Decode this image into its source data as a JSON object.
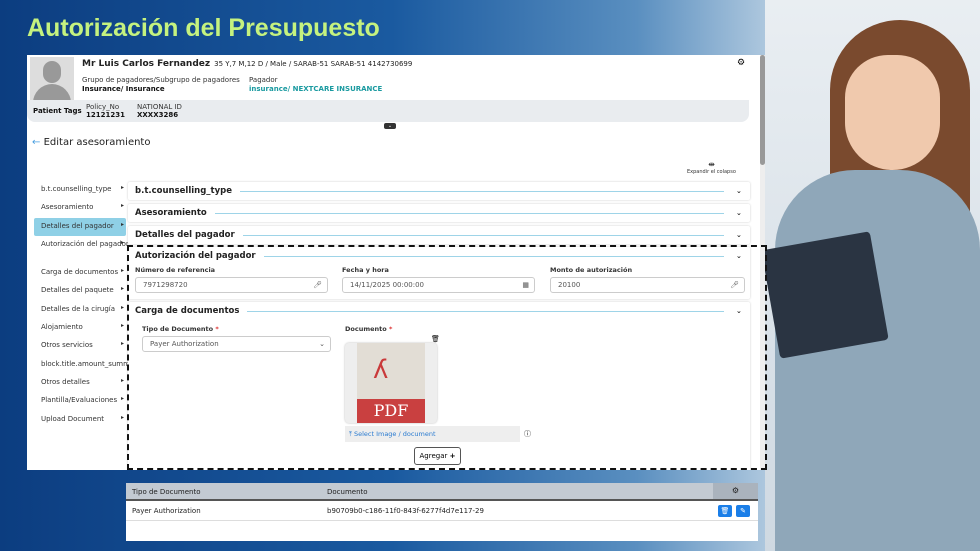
{
  "title": "Autorización del Presupuesto",
  "patient": {
    "name": "Mr Luis Carlos Fernandez",
    "details": "35 Y,7 M,12 D / Male / SARAB-51   SARAB-51   4142730699",
    "group_label": "Grupo de pagadores/Subgrupo de pagadores",
    "group_value": "Insurance/ Insurance",
    "payer_label": "Pagador",
    "payer_value": "insurance/ NEXTCARE INSURANCE",
    "tags_label": "Patient Tags",
    "policy_label": "Policy_No",
    "policy_value": "12121231",
    "national_label": "NATIONAL ID",
    "national_value": "XXXX3286"
  },
  "page_title": "Editar asesoramiento",
  "expand_label": "Expandir el colapso",
  "nav": [
    {
      "label": "b.t.counselling_type"
    },
    {
      "label": "Asesoramiento"
    },
    {
      "label": "Detalles del pagador",
      "active": true
    },
    {
      "label": "Autorización del pagador"
    },
    {
      "label": "Carga de documentos"
    },
    {
      "label": "Detalles del paquete"
    },
    {
      "label": "Detalles de la cirugía"
    },
    {
      "label": "Alojamiento"
    },
    {
      "label": "Otros servicios"
    },
    {
      "label": "block.title.amount_summary"
    },
    {
      "label": "Otros detalles"
    },
    {
      "label": "Plantilla/Evaluaciones"
    },
    {
      "label": "Upload Document"
    }
  ],
  "sections": {
    "s1": "b.t.counselling_type",
    "s2": "Asesoramiento",
    "s3": "Detalles del pagador",
    "s4": "Autorización del pagador",
    "s5": "Carga de documentos"
  },
  "auth": {
    "ref_label": "Número de referencia",
    "ref_value": "7971298720",
    "date_label": "Fecha y hora",
    "date_value": "14/11/2025 00:00:00",
    "amount_label": "Monto de autorización",
    "amount_value": "20100"
  },
  "upload": {
    "type_label": "Tipo de Documento",
    "type_value": "Payer Authorization",
    "doc_label": "Documento",
    "pdf_text": "PDF",
    "select_label": "Select Image / document",
    "add_label": "Agregar"
  },
  "table": {
    "headers": [
      "Tipo de Documento",
      "Documento"
    ],
    "rows": [
      [
        "Payer Authorization",
        "b90709b0-c186-11f0-843f-6277f4d7e117-29"
      ]
    ]
  }
}
